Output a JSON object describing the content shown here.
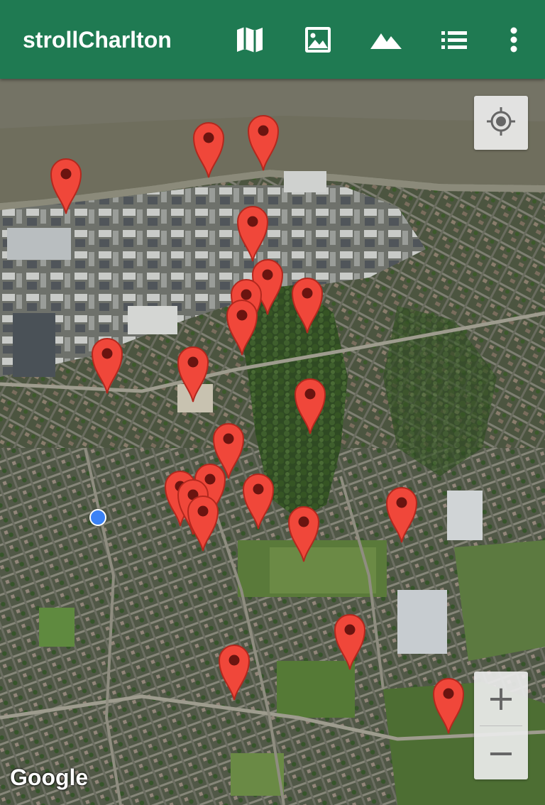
{
  "app": {
    "title": "strollCharlton",
    "accent_color": "#1f7a52"
  },
  "toolbar": {
    "actions": [
      {
        "icon": "map-icon",
        "label": "Map"
      },
      {
        "icon": "image-icon",
        "label": "Photos"
      },
      {
        "icon": "terrain-icon",
        "label": "Terrain"
      },
      {
        "icon": "list-icon",
        "label": "List"
      },
      {
        "icon": "more-vert-icon",
        "label": "More options"
      }
    ]
  },
  "map": {
    "attribution": "Google",
    "marker_color": "#f0473a",
    "my_location_color": "#3b82f6",
    "controls": {
      "zoom_in": "+",
      "zoom_out": "−",
      "my_location_icon": "crosshair-icon"
    },
    "marker_count": 21
  }
}
